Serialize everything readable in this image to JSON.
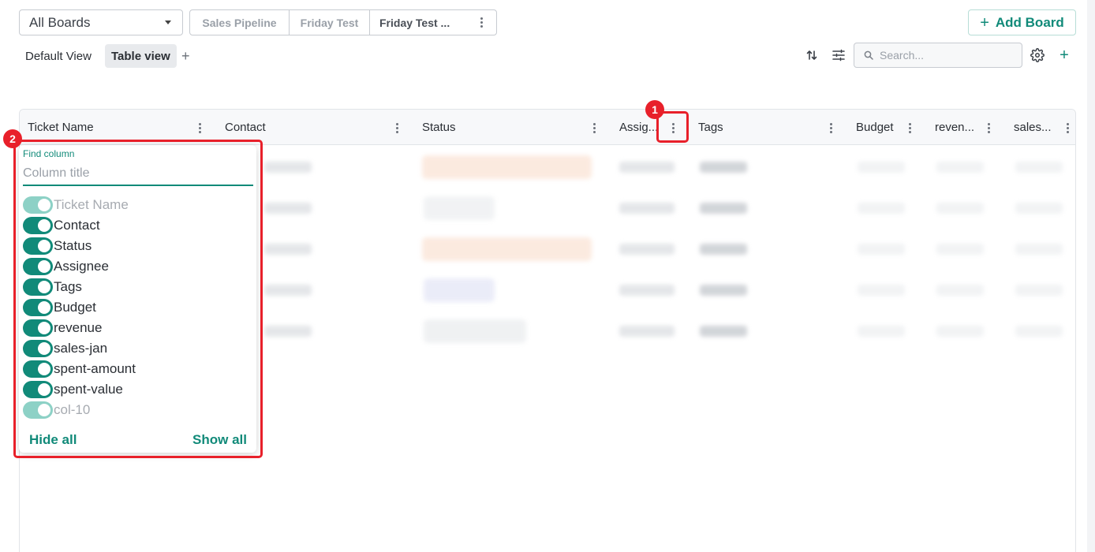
{
  "toolbar": {
    "board_select": "All Boards",
    "board_tabs": [
      "Sales Pipeline",
      "Friday Test",
      "Friday Test ..."
    ],
    "add_board": "Add Board"
  },
  "views": {
    "default": "Default View",
    "table": "Table view"
  },
  "search": {
    "placeholder": "Search..."
  },
  "columns": [
    "Ticket Name",
    "Contact",
    "Status",
    "Assig...",
    "Tags",
    "Budget",
    "reven...",
    "sales..."
  ],
  "annotations": {
    "badge1": "1",
    "badge2": "2"
  },
  "column_picker": {
    "label": "Find column",
    "placeholder": "Column title",
    "items": [
      {
        "name": "Ticket Name",
        "enabled": true,
        "locked": true
      },
      {
        "name": "Contact",
        "enabled": true,
        "locked": false
      },
      {
        "name": "Status",
        "enabled": true,
        "locked": false
      },
      {
        "name": "Assignee",
        "enabled": true,
        "locked": false
      },
      {
        "name": "Tags",
        "enabled": true,
        "locked": false
      },
      {
        "name": "Budget",
        "enabled": true,
        "locked": false
      },
      {
        "name": "revenue",
        "enabled": true,
        "locked": false
      },
      {
        "name": "sales-jan",
        "enabled": true,
        "locked": false
      },
      {
        "name": "spent-amount",
        "enabled": true,
        "locked": false
      },
      {
        "name": "spent-value",
        "enabled": true,
        "locked": false
      },
      {
        "name": "col-10",
        "enabled": true,
        "locked": true
      }
    ],
    "hide_all": "Hide all",
    "show_all": "Show all"
  },
  "colors": {
    "accent": "#118a79",
    "accent_light": "#8dd1c6",
    "annotation": "#e8202a"
  }
}
